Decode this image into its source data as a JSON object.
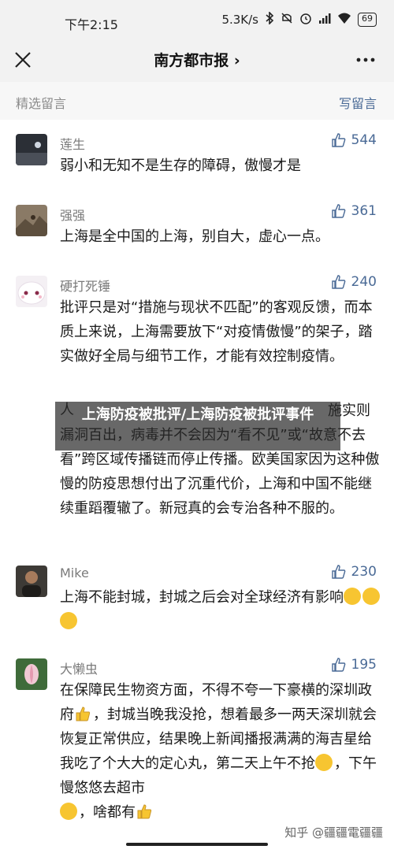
{
  "status": {
    "time": "下午2:15",
    "speed": "5.3K/s",
    "battery": "69",
    "icons": [
      "bluetooth-icon",
      "mute-icon",
      "alarm-icon",
      "signal-icon",
      "wifi-icon",
      "battery-icon"
    ]
  },
  "nav": {
    "title": "南方都市报",
    "chevron": "›"
  },
  "section": {
    "title": "精选留言",
    "write_label": "写留言"
  },
  "comments": [
    {
      "name": "莲生",
      "likes": "544",
      "text": "弱小和无知不是生存的障碍，傲慢才是"
    },
    {
      "name": "强强",
      "likes": "361",
      "text": "上海是全中国的上海，别自大，虚心一点。"
    },
    {
      "name": "硬打死锤",
      "likes": "240",
      "text": "批评只是对“措施与现状不匹配”的客观反馈，而本质上来说，上海需要放下“对疫情傲慢”的架子，踏实做好全局与细节工作，才能有效控制疫情。"
    },
    {
      "name_partial": "人",
      "text_partial": "施实则漏洞百出，病毒并不会因为“看不见”或“故意不去看”跨区域传播链而停止传播。欧美国家因为这种傲慢的防疫思想付出了沉重代价，上海和中国不能继续重蹈覆辙了。新冠真的会专治各种不服的。"
    },
    {
      "name": "Mike",
      "likes": "230",
      "text": "上海不能封城，封城之后会对全球经济有影响"
    },
    {
      "name": "大懒虫",
      "likes": "195",
      "text_a": "在保障民生物资方面，不得不夸一下豪横的深圳政府",
      "text_b": "，封城当晚我没抢，想着最多一两天深圳就会恢复正常供应，结果晚上新闻播报满满的海吉星给我吃了个大大的定心丸，第二天上午不抢",
      "text_c": "，下午慢悠悠去超市",
      "text_d": "，啥都有"
    }
  ],
  "overlay": {
    "text": "上海防疫被批评/上海防疫被批评事件"
  },
  "watermark": "知乎 @疆疆電疆疆",
  "colors": {
    "accent": "#4a6a96",
    "header_bg": "#f2f2f2",
    "muted": "#8c8c8c"
  }
}
